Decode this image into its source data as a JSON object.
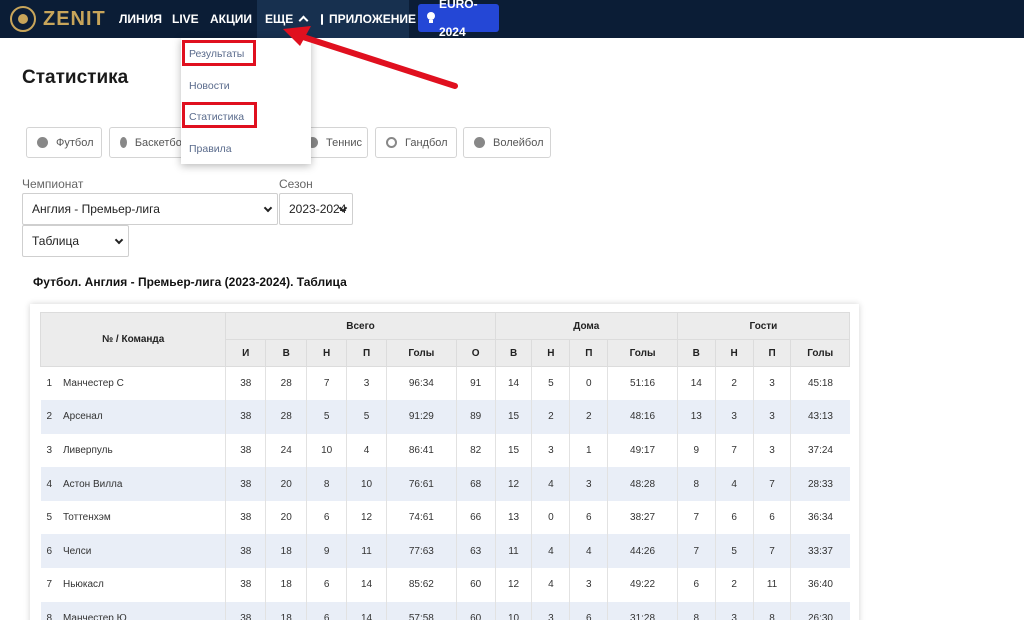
{
  "nav": {
    "logo_text": "ZENIT",
    "items": [
      "ЛИНИЯ",
      "LIVE",
      "АКЦИИ"
    ],
    "more_label": "ЕЩЕ",
    "app_label": "ПРИЛОЖЕНИЕ",
    "euro_label": "EURO-2024",
    "colors": {
      "bar": "#0b1d36",
      "logo": "#c8a55a",
      "euro": "#2447d6",
      "annotation": "#e0101f"
    }
  },
  "dropdown": {
    "items": [
      "Результаты",
      "Новости",
      "Статистика",
      "Правила"
    ],
    "highlighted": [
      "Результаты",
      "Статистика"
    ]
  },
  "page": {
    "title": "Статистика"
  },
  "sports": [
    "Футбол",
    "Баскетбол",
    "Теннис",
    "Гандбол",
    "Волейбол"
  ],
  "filters": {
    "championship_label": "Чемпионат",
    "championship_value": "Англия - Премьер-лига",
    "season_label": "Сезон",
    "season_value": "2023-2024",
    "view_value": "Таблица"
  },
  "table": {
    "title": "Футбол. Англия - Премьер-лига (2023-2024). Таблица",
    "team_header": "№ / Команда",
    "groups": [
      "Всего",
      "Дома",
      "Гости"
    ],
    "columns": [
      "И",
      "В",
      "Н",
      "П",
      "Голы",
      "О",
      "В",
      "Н",
      "П",
      "Голы",
      "В",
      "Н",
      "П",
      "Голы"
    ],
    "rows": [
      [
        "1",
        "Манчестер С",
        "38",
        "28",
        "7",
        "3",
        "96:34",
        "91",
        "14",
        "5",
        "0",
        "51:16",
        "14",
        "2",
        "3",
        "45:18"
      ],
      [
        "2",
        "Арсенал",
        "38",
        "28",
        "5",
        "5",
        "91:29",
        "89",
        "15",
        "2",
        "2",
        "48:16",
        "13",
        "3",
        "3",
        "43:13"
      ],
      [
        "3",
        "Ливерпуль",
        "38",
        "24",
        "10",
        "4",
        "86:41",
        "82",
        "15",
        "3",
        "1",
        "49:17",
        "9",
        "7",
        "3",
        "37:24"
      ],
      [
        "4",
        "Астон Вилла",
        "38",
        "20",
        "8",
        "10",
        "76:61",
        "68",
        "12",
        "4",
        "3",
        "48:28",
        "8",
        "4",
        "7",
        "28:33"
      ],
      [
        "5",
        "Тоттенхэм",
        "38",
        "20",
        "6",
        "12",
        "74:61",
        "66",
        "13",
        "0",
        "6",
        "38:27",
        "7",
        "6",
        "6",
        "36:34"
      ],
      [
        "6",
        "Челси",
        "38",
        "18",
        "9",
        "11",
        "77:63",
        "63",
        "11",
        "4",
        "4",
        "44:26",
        "7",
        "5",
        "7",
        "33:37"
      ],
      [
        "7",
        "Ньюкасл",
        "38",
        "18",
        "6",
        "14",
        "85:62",
        "60",
        "12",
        "4",
        "3",
        "49:22",
        "6",
        "2",
        "11",
        "36:40"
      ],
      [
        "8",
        "Манчестер Ю",
        "38",
        "18",
        "6",
        "14",
        "57:58",
        "60",
        "10",
        "3",
        "6",
        "31:28",
        "8",
        "3",
        "8",
        "26:30"
      ]
    ]
  }
}
